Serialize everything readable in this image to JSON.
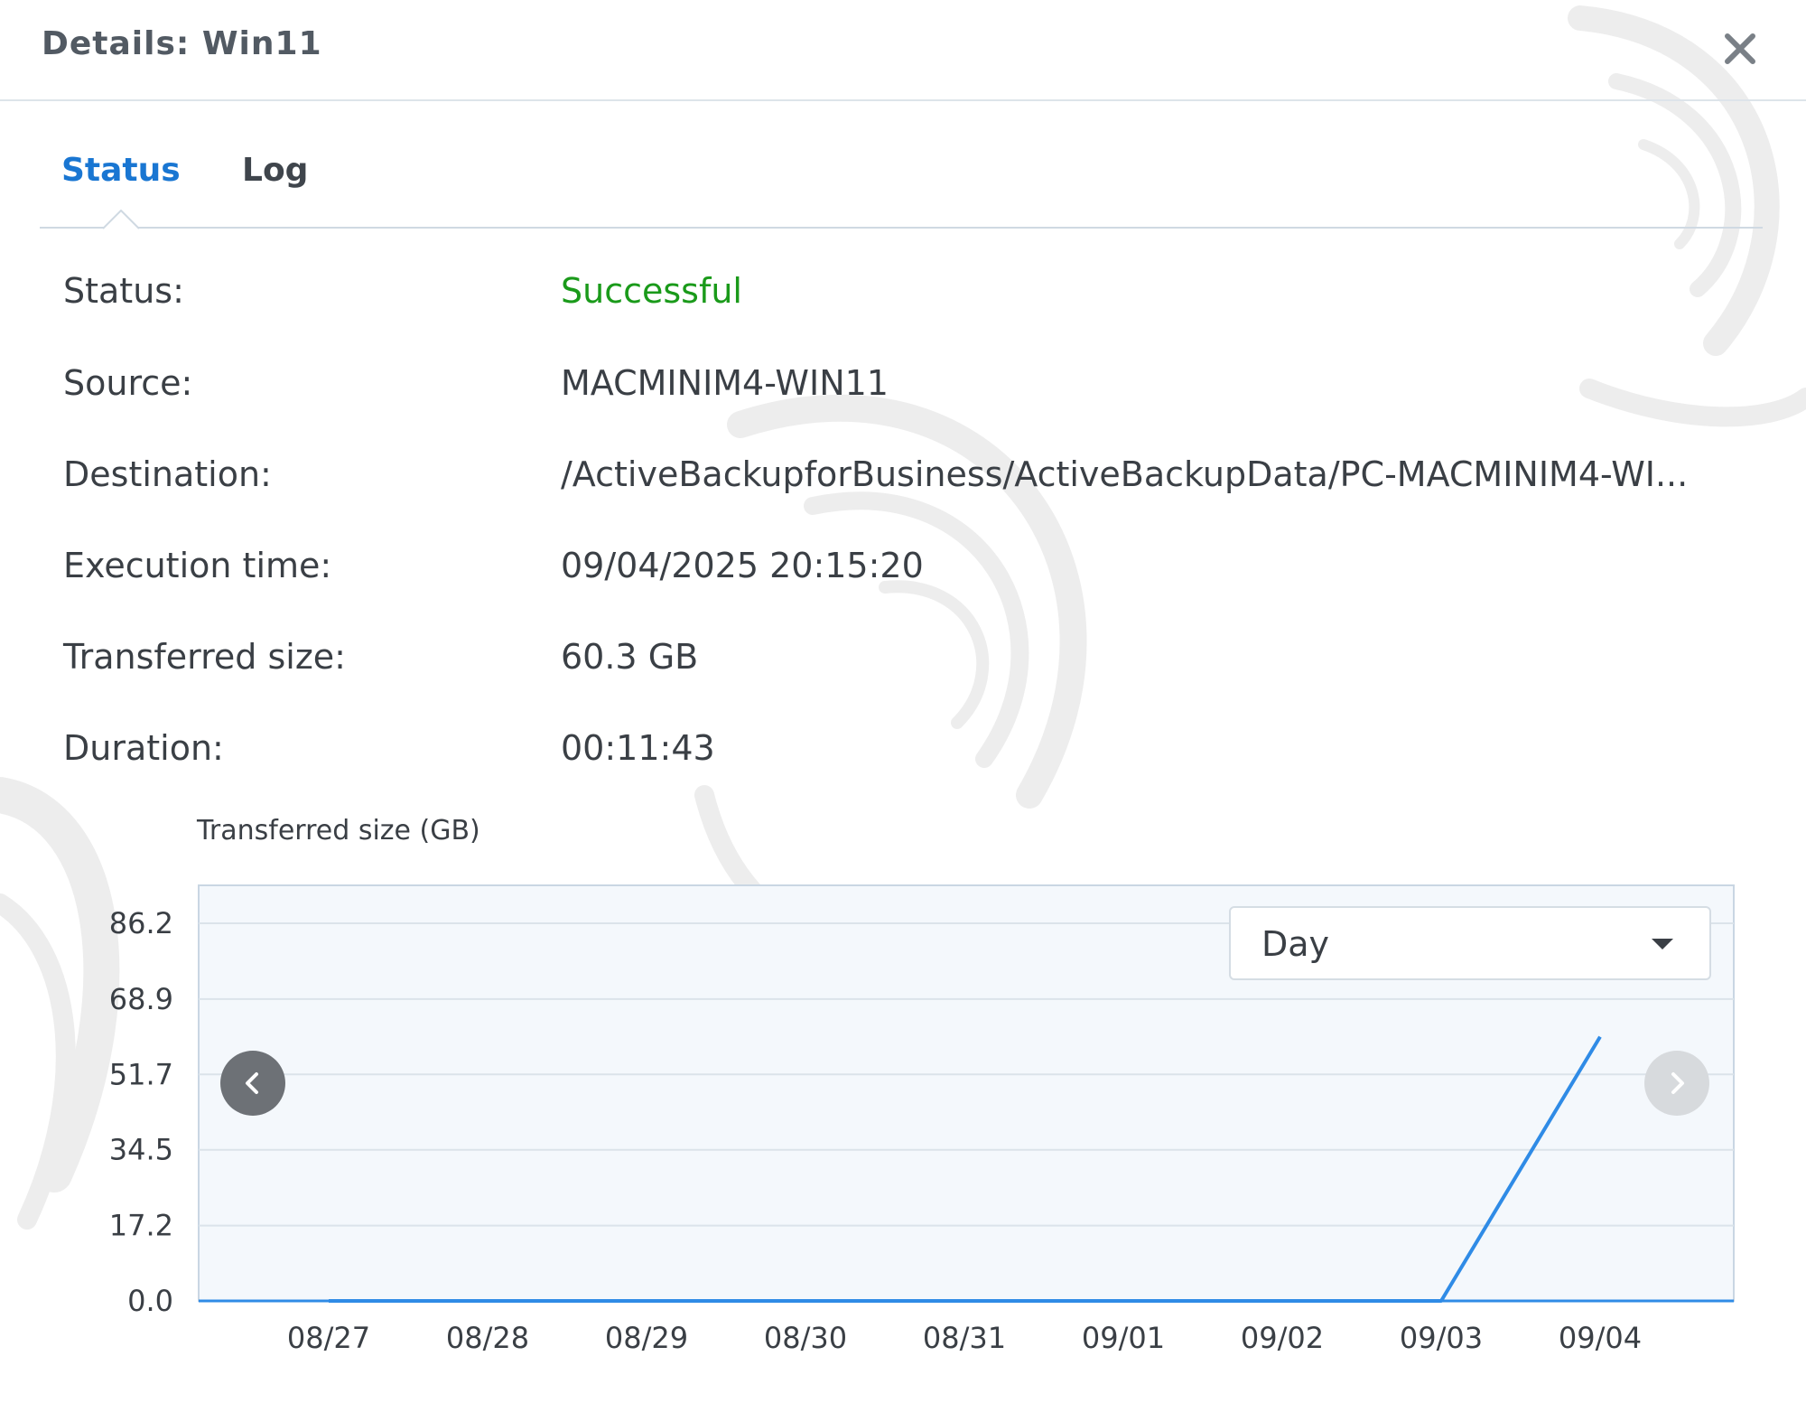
{
  "window": {
    "title": "Details: Win11"
  },
  "tabs": [
    {
      "label": "Status",
      "active": true
    },
    {
      "label": "Log",
      "active": false
    }
  ],
  "details": {
    "status": {
      "label": "Status:",
      "value": "Successful"
    },
    "source": {
      "label": "Source:",
      "value": "MACMINIM4-WIN11"
    },
    "destination": {
      "label": "Destination:",
      "value": "/ActiveBackupforBusiness/ActiveBackupData/PC-MACMINIM4-WI..."
    },
    "execution_time": {
      "label": "Execution time:",
      "value": "09/04/2025 20:15:20"
    },
    "transferred_size": {
      "label": "Transferred size:",
      "value": "60.3 GB"
    },
    "duration": {
      "label": "Duration:",
      "value": "00:11:43"
    }
  },
  "chart_controls": {
    "period": "Day",
    "prev_enabled": true,
    "next_enabled": false
  },
  "colors": {
    "accent": "#1976d2",
    "success": "#1a9a1a",
    "line": "#2f8be6",
    "plot_bg": "#f4f8fc"
  },
  "chart_data": {
    "type": "line",
    "title": "Transferred size (GB)",
    "x": [
      "08/27",
      "08/28",
      "08/29",
      "08/30",
      "08/31",
      "09/01",
      "09/02",
      "09/03",
      "09/04"
    ],
    "series": [
      {
        "values": [
          0,
          0,
          0,
          0,
          0,
          0,
          0,
          0,
          60.3
        ]
      }
    ],
    "yticks": [
      "0.0",
      "17.2",
      "34.5",
      "51.7",
      "68.9",
      "86.2"
    ],
    "ylim": [
      0,
      86.2
    ],
    "grid": true
  }
}
